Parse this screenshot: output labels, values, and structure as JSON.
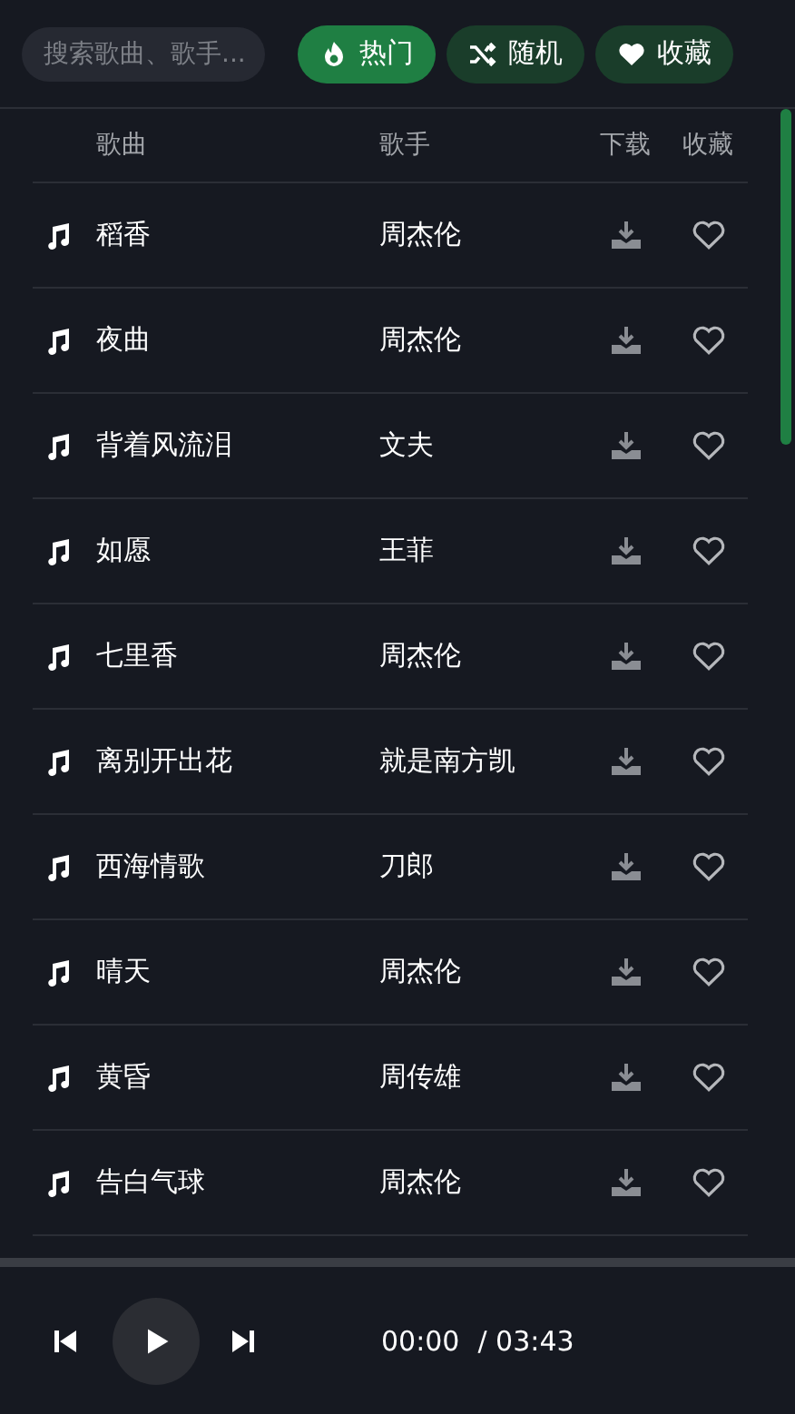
{
  "search": {
    "placeholder": "搜索歌曲、歌手..."
  },
  "tabs": [
    {
      "label": "热门",
      "kind": "hot",
      "selected": true
    },
    {
      "label": "随机",
      "kind": "shuffle",
      "selected": false
    },
    {
      "label": "收藏",
      "kind": "favorites",
      "selected": false
    }
  ],
  "table": {
    "columns": [
      "歌曲",
      "歌手",
      "下载",
      "收藏"
    ],
    "rows": [
      {
        "title": "稻香",
        "artist": "周杰伦",
        "favorite": false
      },
      {
        "title": "夜曲",
        "artist": "周杰伦",
        "favorite": false
      },
      {
        "title": "背着风流泪",
        "artist": "文夫",
        "favorite": false
      },
      {
        "title": "如愿",
        "artist": "王菲",
        "favorite": false
      },
      {
        "title": "七里香",
        "artist": "周杰伦",
        "favorite": false
      },
      {
        "title": "离别开出花",
        "artist": "就是南方凯",
        "favorite": false
      },
      {
        "title": "西海情歌",
        "artist": "刀郎",
        "favorite": false
      },
      {
        "title": "晴天",
        "artist": "周杰伦",
        "favorite": false
      },
      {
        "title": "黄昏",
        "artist": "周传雄",
        "favorite": false
      },
      {
        "title": "告白气球",
        "artist": "周杰伦",
        "favorite": false
      }
    ]
  },
  "player": {
    "playing": false,
    "current_time": "00:00",
    "total_time": "/ 03:43"
  }
}
